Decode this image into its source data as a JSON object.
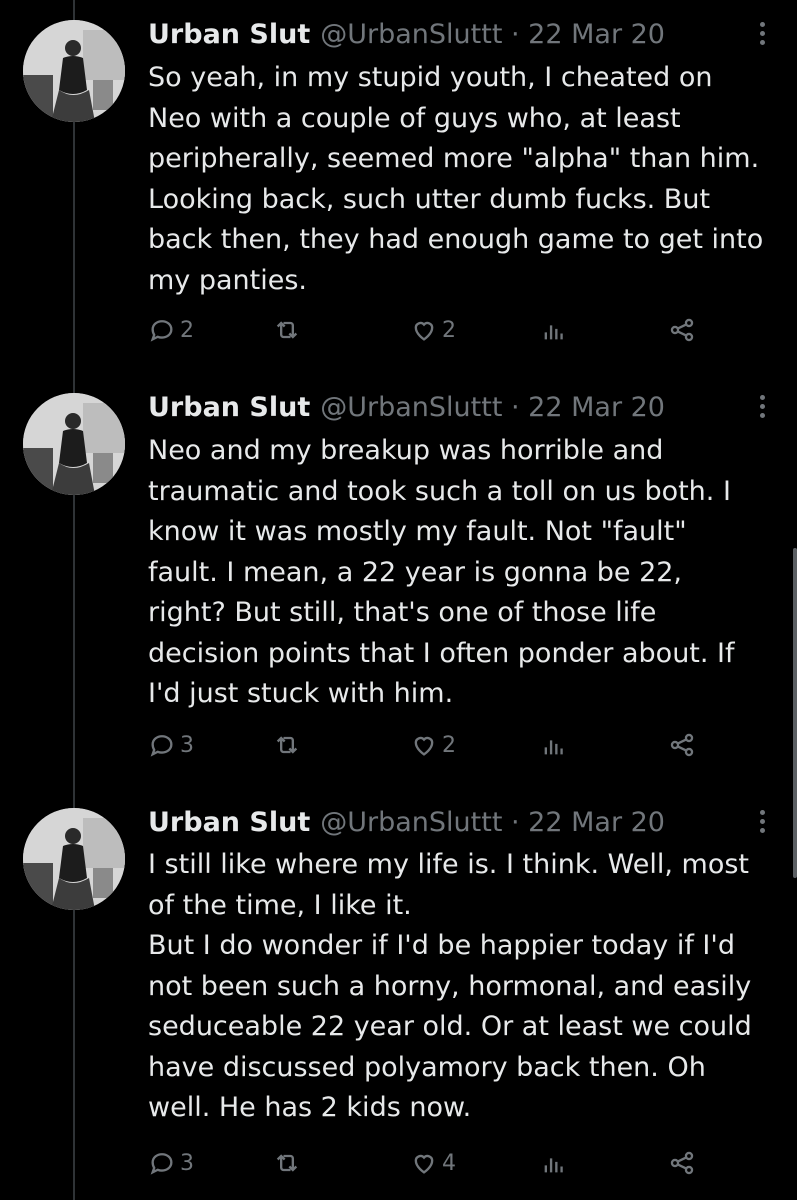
{
  "tweets": [
    {
      "name": "Urban Slut",
      "meta": "@UrbanSluttt · 22 Mar 20",
      "lines": [
        "So yeah, in my stupid youth, I cheated on",
        "Neo with a couple of guys who, at least",
        "peripherally, seemed more \"alpha\" than him.",
        "Looking back, such utter dumb fucks. But",
        "back then, they had enough game to get into",
        "my panties."
      ],
      "replies": "2",
      "likes": "2"
    },
    {
      "name": "Urban Slut",
      "meta": "@UrbanSluttt · 22 Mar 20",
      "lines": [
        "Neo and my breakup was horrible and",
        "traumatic and took such a toll on us both. I",
        "know it was mostly my fault. Not \"fault\"",
        "fault. I mean, a 22 year is gonna be 22,",
        "right? But still, that's one of those life",
        "decision points that I often ponder about. If",
        "I'd just stuck with him."
      ],
      "replies": "3",
      "likes": "2"
    },
    {
      "name": "Urban Slut",
      "meta": "@UrbanSluttt · 22 Mar 20",
      "lines": [
        "I still like where my life is. I think. Well, most",
        "of the time, I like it.",
        "But I do wonder if I'd be happier today if I'd",
        "not been such a horny, hormonal, and easily",
        "seduceable 22 year old. Or at least we could",
        "have discussed polyamory back then. Oh",
        "well. He has 2 kids now."
      ],
      "replies": "3",
      "likes": "4"
    }
  ],
  "icons": {
    "reply": "reply-icon",
    "retweet": "retweet-icon",
    "like": "heart-icon",
    "analytics": "analytics-icon",
    "share": "share-icon",
    "more": "more-icon"
  },
  "colors": {
    "background": "#000000",
    "text": "#e7e9ea",
    "muted": "#71767b"
  }
}
